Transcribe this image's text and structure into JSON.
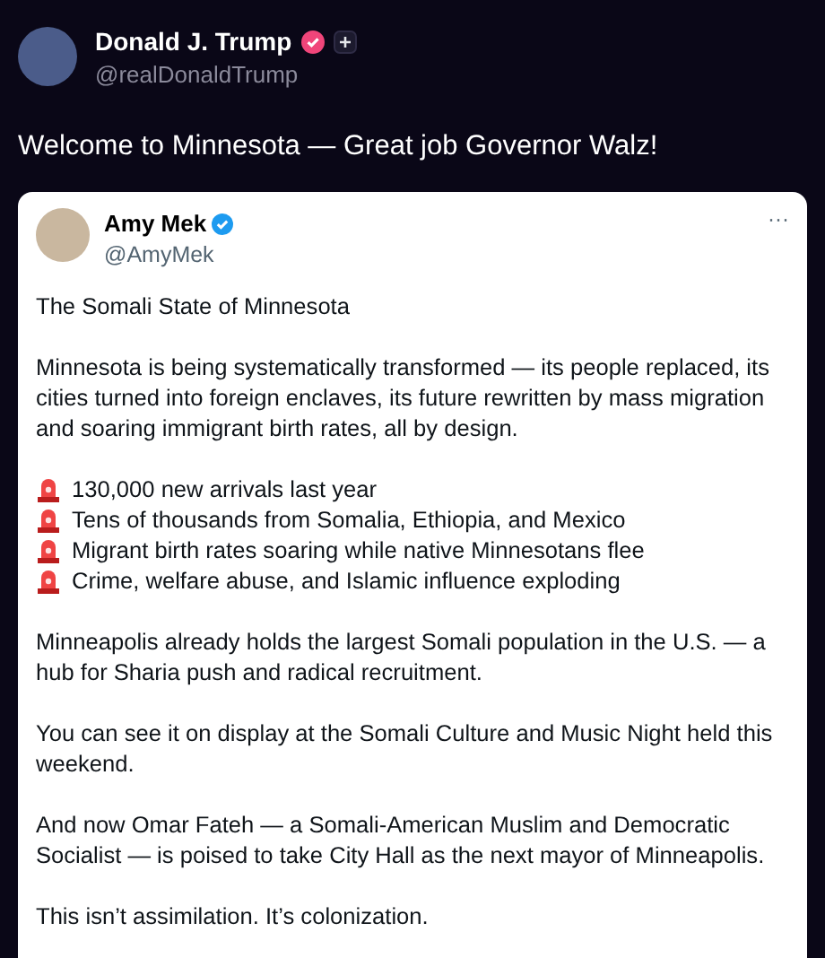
{
  "author": {
    "name": "Donald J. Trump",
    "handle": "@realDonaldTrump"
  },
  "post_text": "Welcome to Minnesota — Great job Governor Walz!",
  "quoted": {
    "name": "Amy Mek",
    "handle": "@AmyMek",
    "more": "···",
    "blocks": [
      {
        "kind": "paragraph",
        "text": "The Somali State of Minnesota"
      },
      {
        "kind": "paragraph",
        "text": "Minnesota is being systematically transformed — its people replaced, its cities turned into foreign enclaves, its future rewritten by mass migration and soaring immigrant birth rates, all by design."
      },
      {
        "kind": "list",
        "items": [
          "130,000 new arrivals last year",
          "Tens of thousands from Somalia, Ethiopia, and Mexico",
          "Migrant birth rates soaring while native Minnesotans flee",
          "Crime, welfare abuse, and Islamic influence exploding"
        ]
      },
      {
        "kind": "paragraph",
        "text": "Minneapolis already holds the largest Somali population in the U.S. — a hub for Sharia push and radical recruitment."
      },
      {
        "kind": "paragraph",
        "text": "You can see it on display at the Somali Culture and Music Night held this weekend."
      },
      {
        "kind": "paragraph",
        "text": "And now Omar Fateh — a Somali-American Muslim and Democratic Socialist — is poised to take City Hall as the next mayor of Minneapolis."
      },
      {
        "kind": "paragraph",
        "text": "This isn’t assimilation. It’s colonization."
      }
    ]
  }
}
